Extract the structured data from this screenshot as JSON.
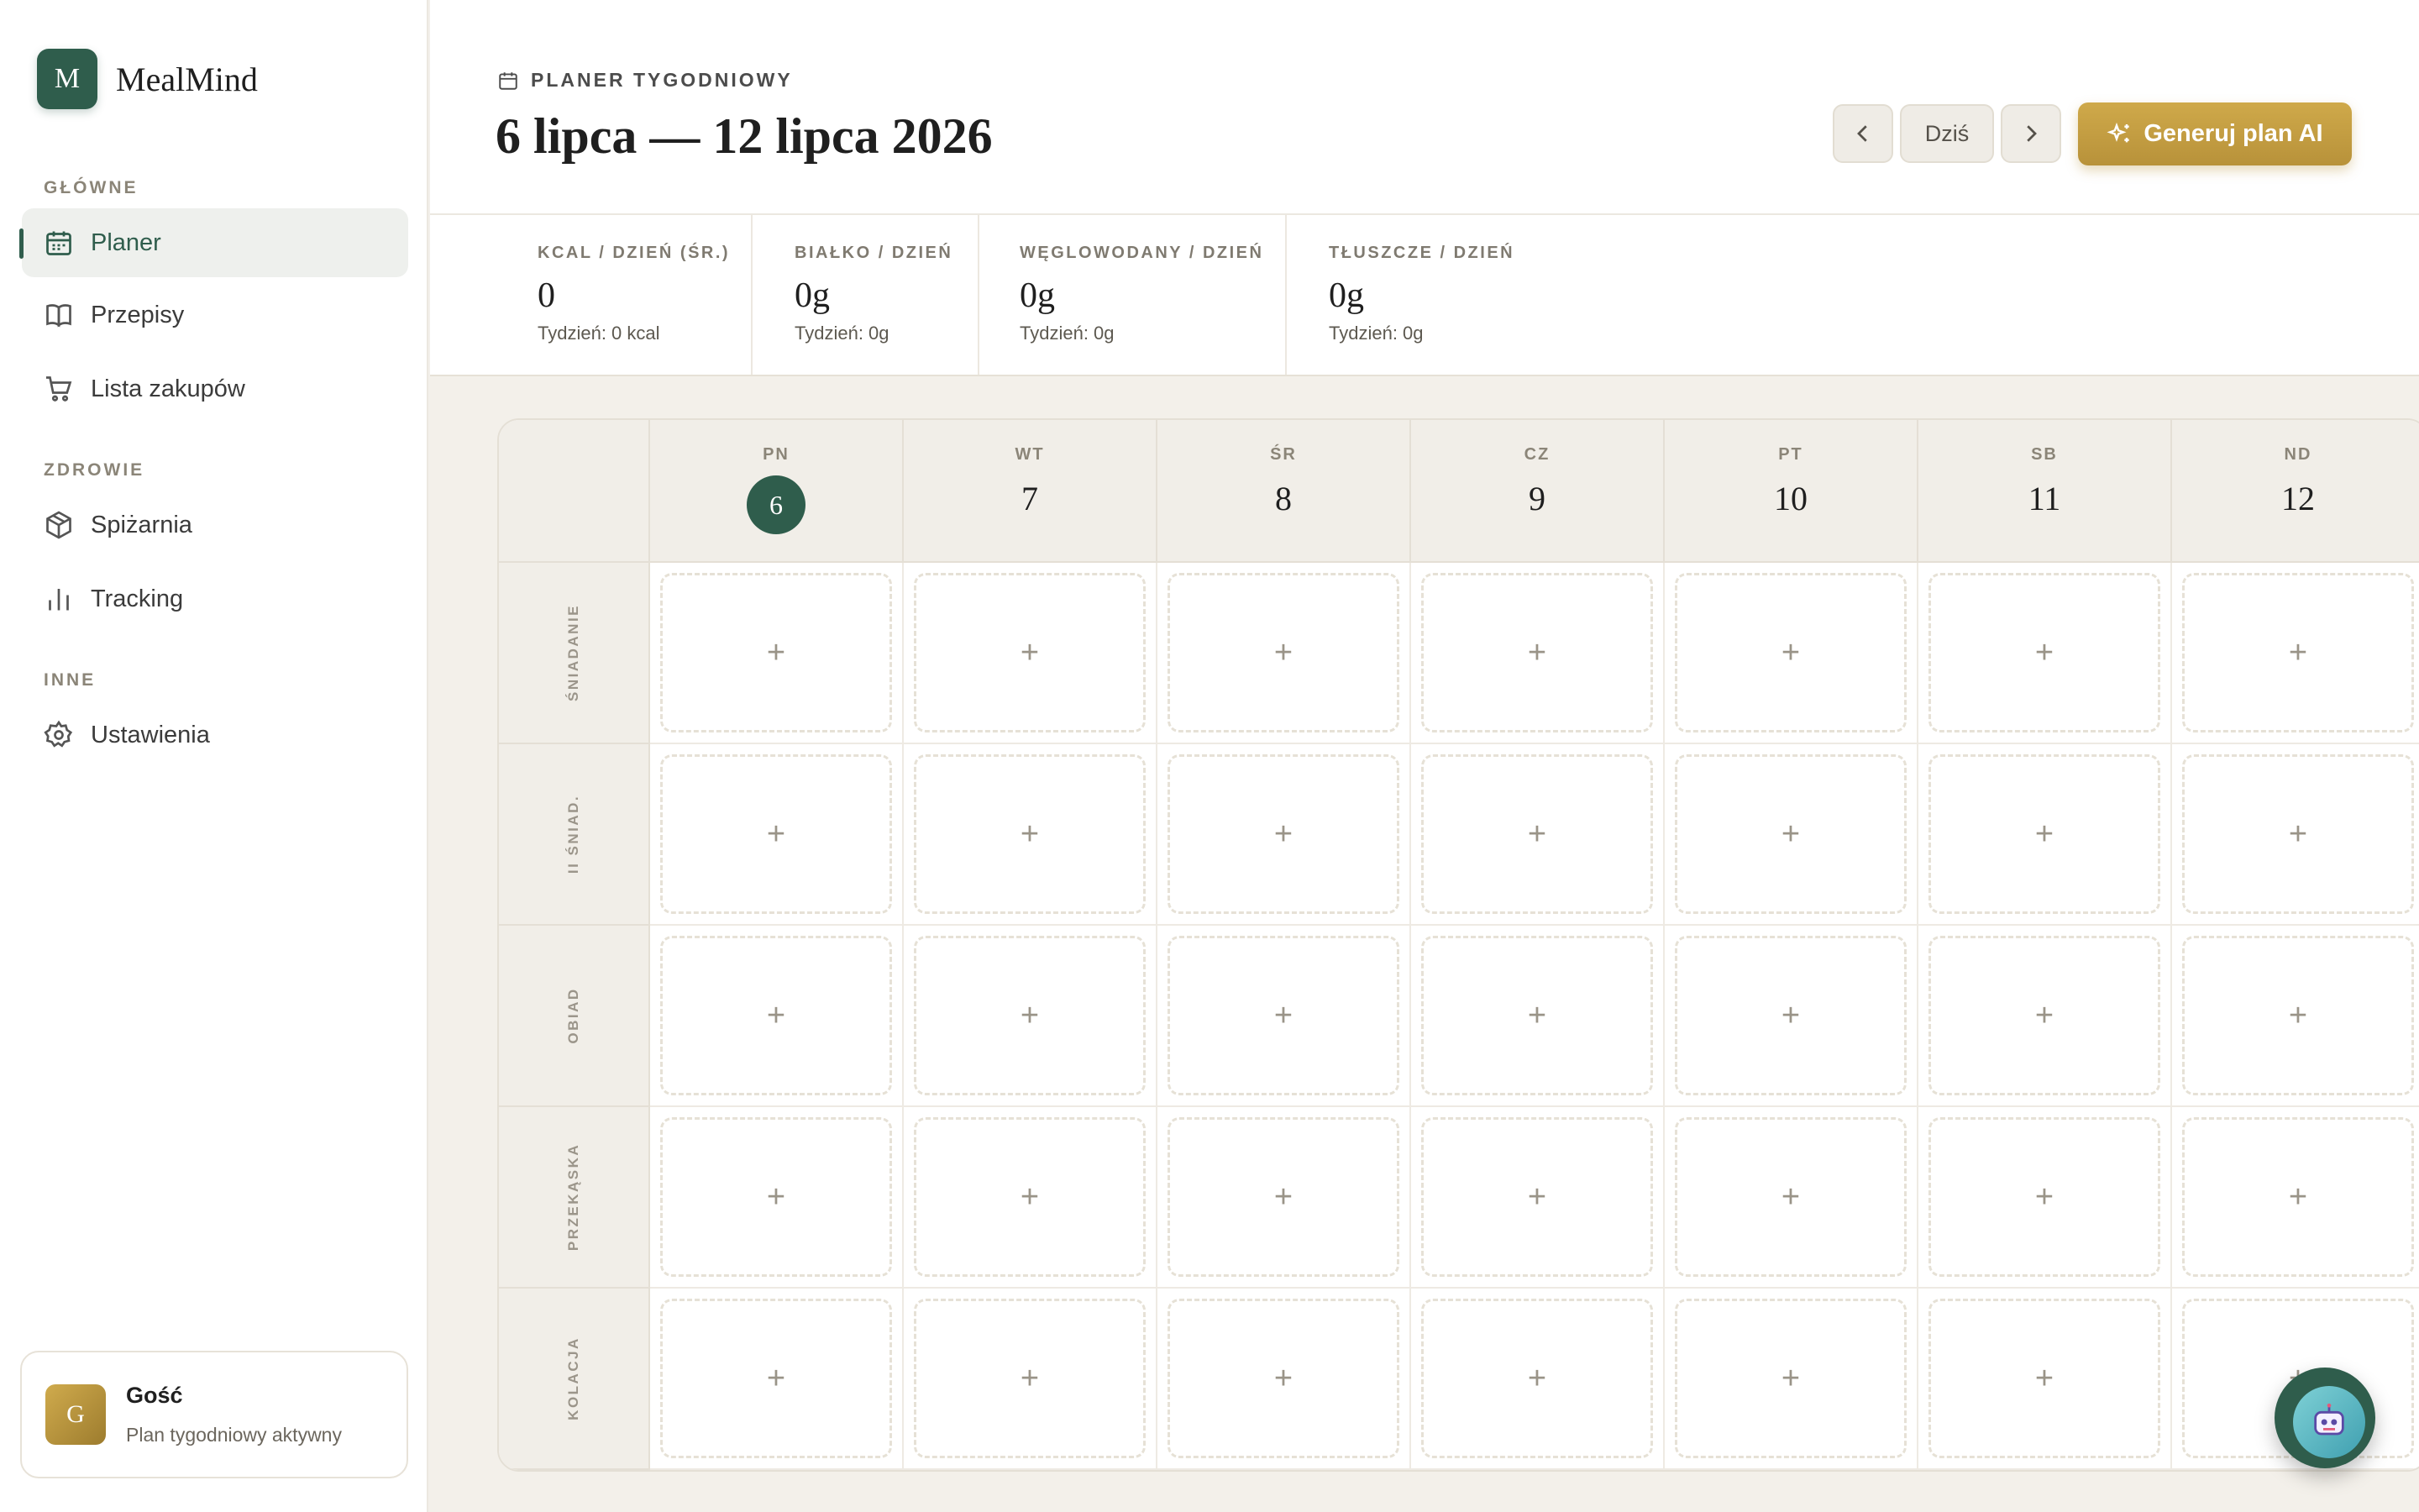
{
  "brand": {
    "initial": "M",
    "name": "MealMind"
  },
  "sidebar": {
    "sections": [
      {
        "label": "GŁÓWNE"
      },
      {
        "label": "ZDROWIE"
      },
      {
        "label": "INNE"
      }
    ],
    "items": [
      {
        "label": "Planer",
        "icon": "calendar-icon",
        "active": true
      },
      {
        "label": "Przepisy",
        "icon": "book-icon"
      },
      {
        "label": "Lista zakupów",
        "icon": "cart-icon"
      },
      {
        "label": "Spiżarnia",
        "icon": "box-icon"
      },
      {
        "label": "Tracking",
        "icon": "bar-chart-icon"
      },
      {
        "label": "Ustawienia",
        "icon": "gear-icon"
      }
    ]
  },
  "user": {
    "initial": "G",
    "name": "Gość",
    "status": "Plan tygodniowy aktywny"
  },
  "header": {
    "eyebrow": "PLANER TYGODNIOWY",
    "title": "6 lipca — 12 lipca 2026",
    "today_label": "Dziś",
    "generate_label": "Generuj plan AI"
  },
  "stats": [
    {
      "label": "KCAL / DZIEŃ (ŚR.)",
      "value": "0",
      "sub": "Tydzień: 0 kcal"
    },
    {
      "label": "BIAŁKO / DZIEŃ",
      "value": "0g",
      "sub": "Tydzień: 0g"
    },
    {
      "label": "WĘGLOWODANY / DZIEŃ",
      "value": "0g",
      "sub": "Tydzień: 0g"
    },
    {
      "label": "TŁUSZCZE / DZIEŃ",
      "value": "0g",
      "sub": "Tydzień: 0g"
    }
  ],
  "grid": {
    "days": [
      {
        "name": "PN",
        "num": "6",
        "today": true
      },
      {
        "name": "WT",
        "num": "7"
      },
      {
        "name": "ŚR",
        "num": "8"
      },
      {
        "name": "CZ",
        "num": "9"
      },
      {
        "name": "PT",
        "num": "10"
      },
      {
        "name": "SB",
        "num": "11"
      },
      {
        "name": "ND",
        "num": "12"
      }
    ],
    "meals": [
      "ŚNIADANIE",
      "II ŚNIAD.",
      "OBIAD",
      "PRZEKĄSKA",
      "KOLACJA"
    ],
    "add_symbol": "+"
  },
  "colors": {
    "primary": "#2f5d4c",
    "accent": "#c9a244",
    "background": "#f3f0ea"
  }
}
